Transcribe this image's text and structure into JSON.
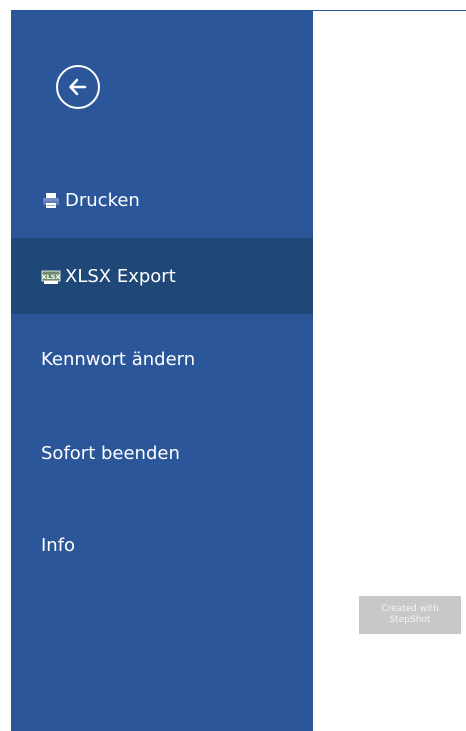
{
  "backstage": {
    "back_icon": "back-arrow-circle-icon",
    "items": [
      {
        "label": "Drucken",
        "icon": "printer-icon",
        "selected": false
      },
      {
        "label": "XLSX Export",
        "icon": "xlsx-file-icon",
        "selected": true
      },
      {
        "label": "Kennwort ändern",
        "selected": false
      },
      {
        "label": "Sofort beenden",
        "selected": false
      },
      {
        "label": "Info",
        "selected": false
      }
    ]
  },
  "watermark": {
    "line1": "Created with",
    "line2": "StepShot"
  },
  "colors": {
    "sidebar": "#2b579a",
    "selected": "#1f4777",
    "text": "#ffffff"
  }
}
